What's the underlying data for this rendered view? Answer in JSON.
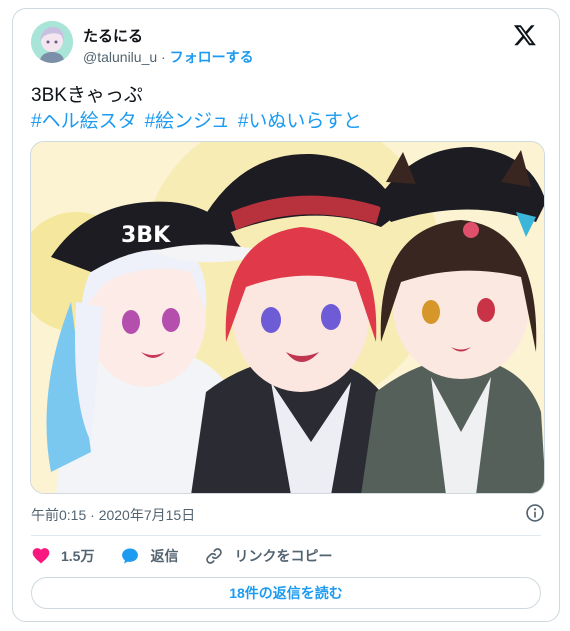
{
  "author": {
    "display_name": "たるにる",
    "handle": "@talunilu_u",
    "separator": "·",
    "follow_label": "フォローする"
  },
  "tweet": {
    "text": "3BKきゃっぷ",
    "hashtags": [
      "#ヘル絵スタ",
      "#絵ンジュ",
      "#いぬいらすと"
    ]
  },
  "media": {
    "cap_text": "3BK"
  },
  "timestamp": "午前0:15 · 2020年7月15日",
  "actions": {
    "like_count": "1.5万",
    "reply_label": "返信",
    "copy_link_label": "リンクをコピー"
  },
  "read_replies_label": "18件の返信を読む",
  "colors": {
    "link_blue": "#1d9bf0",
    "like_pink": "#f91880",
    "muted_text": "#536471",
    "border": "#cfd9de"
  },
  "icons": [
    "x-logo-icon",
    "heart-icon",
    "reply-bubble-icon",
    "link-icon",
    "info-icon"
  ]
}
